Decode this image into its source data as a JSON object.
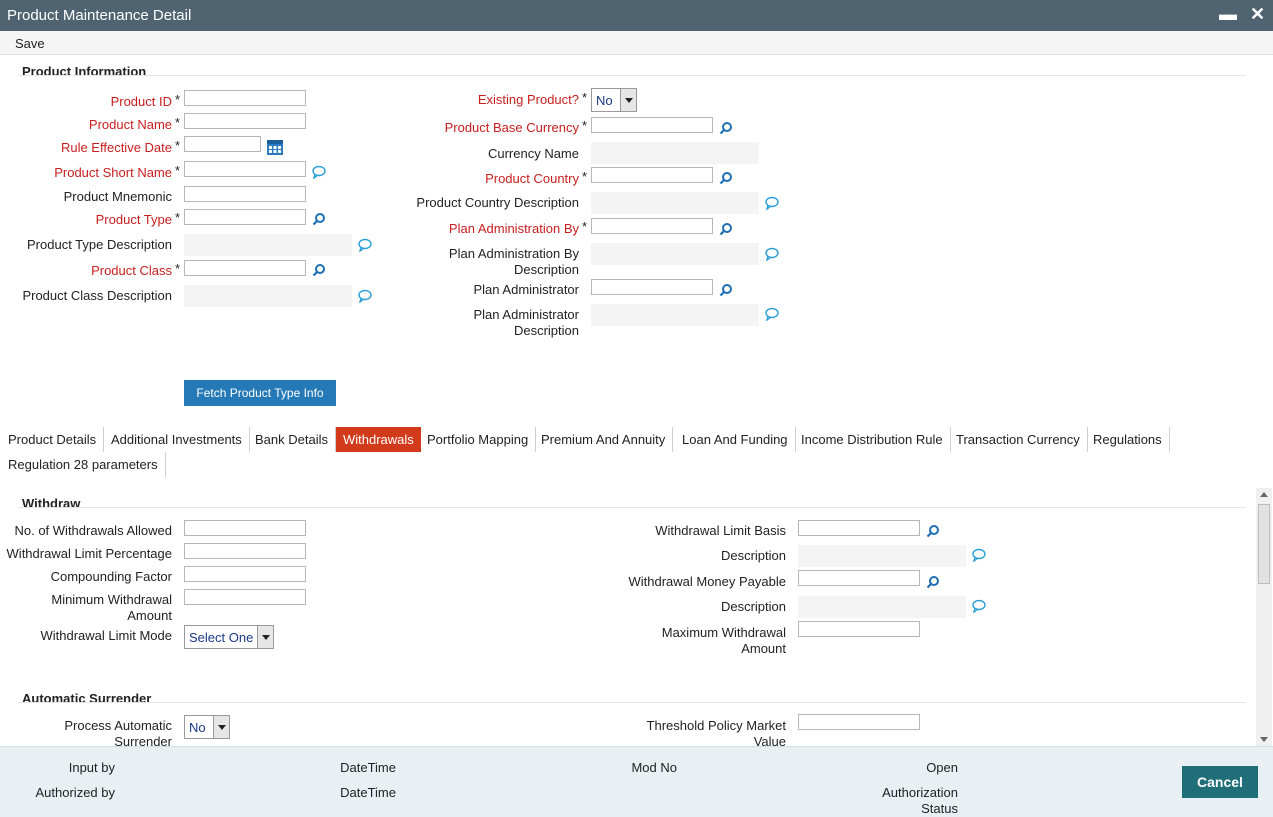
{
  "window": {
    "title": "Product Maintenance Detail",
    "minimize": "▬",
    "close": "✕"
  },
  "menu": {
    "save": "Save"
  },
  "product_info": {
    "section_title": "Product Information",
    "product_id": "Product ID",
    "product_name": "Product Name",
    "rule_effective_date": "Rule Effective Date",
    "product_short_name": "Product Short Name",
    "product_mnemonic": "Product Mnemonic",
    "product_type": "Product Type",
    "product_type_description": "Product Type Description",
    "product_class": "Product Class",
    "product_class_description": "Product Class Description",
    "existing_product": "Existing Product?",
    "existing_product_value": "No",
    "product_base_currency": "Product Base Currency",
    "currency_name": "Currency Name",
    "product_country": "Product Country",
    "product_country_description": "Product Country Description",
    "plan_administration_by": "Plan Administration By",
    "plan_administration_by_description_1": "Plan Administration By",
    "plan_administration_by_description_2": "Description",
    "plan_administrator": "Plan Administrator",
    "plan_administrator_description_1": "Plan Administrator",
    "plan_administrator_description_2": "Description",
    "fetch_button": "Fetch Product Type Info",
    "required_star": "*"
  },
  "tabs": [
    "Product Details",
    "Additional Investments",
    "Bank Details",
    "Withdrawals",
    "Portfolio Mapping",
    "Premium And Annuity",
    "Loan And Funding",
    "Income Distribution Rule",
    "Transaction Currency",
    "Regulations",
    "Regulation 28 parameters"
  ],
  "withdraw": {
    "section_title": "Withdraw",
    "no_of_withdrawals": "No. of Withdrawals Allowed",
    "withdrawal_limit_percentage": "Withdrawal Limit Percentage",
    "compounding_factor": "Compounding Factor",
    "minimum_withdrawal_1": "Minimum Withdrawal",
    "minimum_withdrawal_2": "Amount",
    "withdrawal_limit_mode": "Withdrawal Limit Mode",
    "withdrawal_limit_mode_value": "Select One",
    "withdrawal_limit_basis": "Withdrawal Limit Basis",
    "description_1": "Description",
    "withdrawal_money_payable": "Withdrawal Money Payable",
    "description_2": "Description",
    "maximum_withdrawal_1": "Maximum Withdrawal",
    "maximum_withdrawal_2": "Amount"
  },
  "auto_surrender": {
    "section_title": "Automatic Surrender",
    "process_1": "Process Automatic",
    "process_2": "Surrender",
    "process_value": "No",
    "threshold_1": "Threshold Policy Market",
    "threshold_2": "Value"
  },
  "footer": {
    "input_by": "Input by",
    "datetime_1": "DateTime",
    "mod_no": "Mod No",
    "open": "Open",
    "authorized_by": "Authorized by",
    "datetime_2": "DateTime",
    "authorization_1": "Authorization",
    "authorization_2": "Status",
    "cancel": "Cancel"
  },
  "colors": {
    "accent": "#2479b6",
    "active_tab": "#d13b1c",
    "required": "#c81e1e",
    "titlebar": "#4f6470",
    "cancel": "#1f6e78"
  }
}
